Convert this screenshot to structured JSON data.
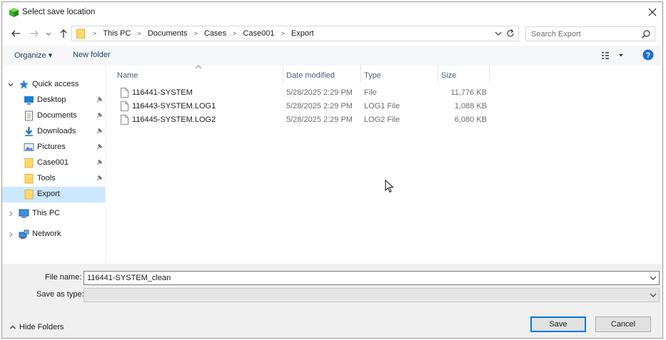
{
  "window": {
    "title": "Select save location"
  },
  "address": {
    "crumbs": [
      "This PC",
      "Documents",
      "Cases",
      "Case001",
      "Export"
    ]
  },
  "search": {
    "placeholder": "Search Export"
  },
  "toolbar": {
    "organize_label": "Organize ▾",
    "new_folder_label": "New folder"
  },
  "nav": {
    "quick_access": "Quick access",
    "items": [
      {
        "label": "Desktop",
        "icon": "desktop-icon",
        "pinned": true
      },
      {
        "label": "Documents",
        "icon": "documents-icon",
        "pinned": true
      },
      {
        "label": "Downloads",
        "icon": "downloads-icon",
        "pinned": true
      },
      {
        "label": "Pictures",
        "icon": "pictures-icon",
        "pinned": true
      },
      {
        "label": "Case001",
        "icon": "folder-icon",
        "pinned": true
      },
      {
        "label": "Tools",
        "icon": "folder-icon",
        "pinned": true
      },
      {
        "label": "Export",
        "icon": "folder-icon",
        "pinned": false,
        "selected": true
      }
    ],
    "this_pc": "This PC",
    "network": "Network"
  },
  "columns": {
    "name": "Name",
    "date": "Date modified",
    "type": "Type",
    "size": "Size"
  },
  "files": [
    {
      "name": "116441-SYSTEM",
      "date": "5/28/2025 2:29 PM",
      "type": "File",
      "size": "11,776 KB"
    },
    {
      "name": "116443-SYSTEM.LOG1",
      "date": "5/28/2025 2:29 PM",
      "type": "LOG1 File",
      "size": "1,088 KB"
    },
    {
      "name": "116445-SYSTEM.LOG2",
      "date": "5/28/2025 2:29 PM",
      "type": "LOG2 File",
      "size": "6,080 KB"
    }
  ],
  "bottom": {
    "file_name_label": "File name:",
    "file_name_value": "116441-SYSTEM_clean",
    "save_as_type_label": "Save as type:",
    "save_as_type_value": "",
    "hide_folders_label": "Hide Folders",
    "save_label": "Save",
    "cancel_label": "Cancel"
  },
  "colors": {
    "accent": "#0078d7",
    "selected": "#cce8ff",
    "link": "#1e3f66",
    "folder": "#ffd966"
  }
}
